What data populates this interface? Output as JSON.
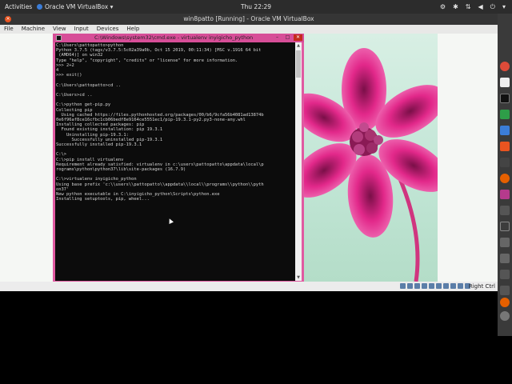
{
  "topbar": {
    "activities": "Activities",
    "app_name": "Oracle VM VirtualBox ▾",
    "clock": "Thu 22:29"
  },
  "window": {
    "title": "win8patto [Running] - Oracle VM VirtualBox"
  },
  "menu": [
    "File",
    "Machine",
    "View",
    "Input",
    "Devices",
    "Help"
  ],
  "cmd": {
    "title": "C:\\Windows\\system32\\cmd.exe - virtualenv  inyigicho_python",
    "lines": [
      "C:\\Users\\pattopatto>python",
      "Python 3.7.5 (tags/v3.7.5:5c02a39a0b, Oct 15 2019, 00:11:34) [MSC v.1916 64 bit",
      " (AMD64)] on win32",
      "Type \"help\", \"copyright\", \"credits\" or \"license\" for more information.",
      ">>> 2+2",
      "4",
      ">>> exit()",
      "",
      "C:\\Users\\pattopatto>cd ..",
      "",
      "C:\\Users>cd ..",
      "",
      "C:\\>python get-pip.py",
      "Collecting pip",
      "  Using cached https://files.pythonhosted.org/packages/00/b6/9cfa56b4081ad13874b",
      "0e6f96af8ce16cfbc1cb06bedf8e9164ce5551ec1/pip-19.3.1-py2.py3-none-any.whl",
      "Installing collected packages: pip",
      "  Found existing installation: pip 19.3.1",
      "    Uninstalling pip-19.3.1:",
      "      Successfully uninstalled pip-19.3.1",
      "Successfully installed pip-19.3.1",
      "",
      "C:\\>",
      "C:\\>pip install virtualenv",
      "Requirement already satisfied: virtualenv in c:\\users\\pattopatto\\appdata\\local\\p",
      "rograms\\python\\python37\\lib\\site-packages (16.7.9)",
      "",
      "C:\\>virtualenv inyigicho_python",
      "Using base prefix 'c:\\\\users\\\\pattopatto\\\\appdata\\\\local\\\\programs\\\\python\\\\pyth",
      "on37'",
      "New python executable in C:\\inyigicho_python\\Scripts\\python.exe",
      "Installing setuptools, pip, wheel..."
    ]
  },
  "statusbar": {
    "host_key": "Right Ctrl"
  },
  "colors": {
    "cmd_frame": "#e05aa1",
    "petal": "#e2288a",
    "ubuntu_orange": "#e95420"
  }
}
